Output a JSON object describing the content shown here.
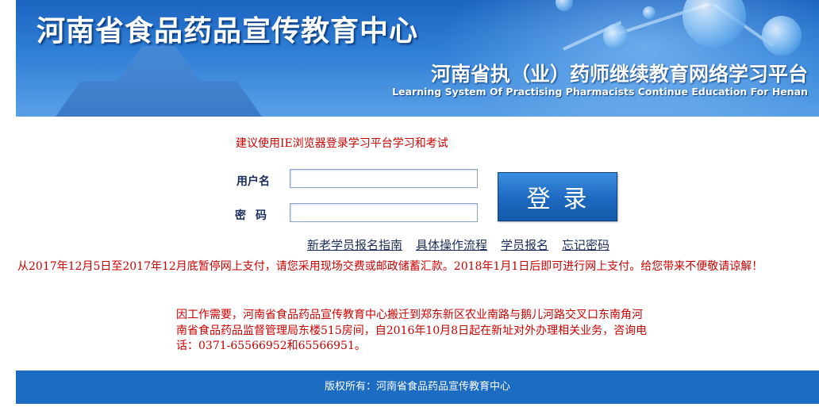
{
  "banner": {
    "title": "河南省食品药品宣传教育中心",
    "subtitle_cn": "河南省执（业）药师继续教育网络学习平台",
    "subtitle_en": "Learning System Of Practising Pharmacists Continue Education For Henan"
  },
  "login": {
    "browser_notice": "建议使用IE浏览器登录学习平台学习和考试",
    "username_label": "用户名",
    "password_label": "密码",
    "username_value": "",
    "password_value": "",
    "submit_label": "登录"
  },
  "links": [
    {
      "label": "新老学员报名指南"
    },
    {
      "label": "具体操作流程"
    },
    {
      "label": "学员报名"
    },
    {
      "label": "忘记密码"
    }
  ],
  "notices": {
    "payment": "从2017年12月5日至2017年12月底暂停网上支付，请您采用现场交费或邮政储蓄汇款。2018年1月1日后即可进行网上支付。给您带来不便敬请谅解！",
    "relocation": "因工作需要，河南省食品药品宣传教育中心搬迁到郑东新区农业南路与鹅儿河路交叉口东南角河南省食品药品监督管理局东楼515房间，自2016年10月8日起在新址对外办理相关业务，咨询电话：0371-65566952和65566951。"
  },
  "footer": {
    "copyright": "版权所有：河南省食品药品宣传教育中心"
  },
  "colors": {
    "brand_blue": "#1d6cc4",
    "notice_red": "#cc0000",
    "label_navy": "#1a2d5a"
  }
}
